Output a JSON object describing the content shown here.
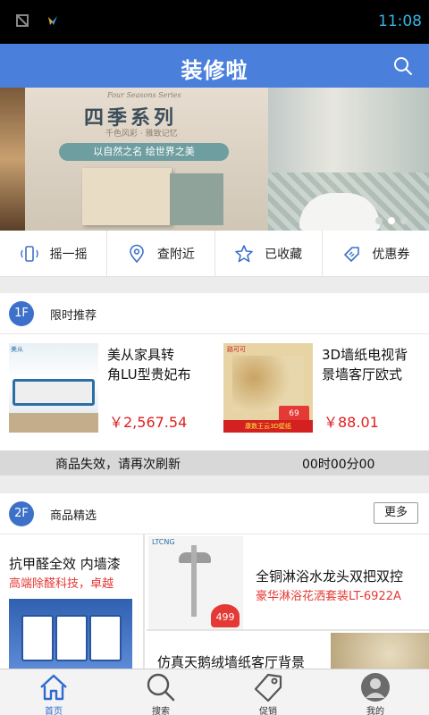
{
  "status_bar": {
    "time": "11:08",
    "icons": [
      "no-sim-icon",
      "app-notification-icon"
    ]
  },
  "app_bar": {
    "title": "装修啦",
    "search_icon": "search-icon"
  },
  "banner": {
    "slogan_en": "Four Seasons Series",
    "title": "四季系列",
    "subtitle": "千色风彩 · 雅致记忆",
    "pill": "以自然之名 绘世界之美",
    "page_count": 3,
    "active_page": 2
  },
  "quick_actions": [
    {
      "label": "摇一摇",
      "icon": "shake-phone-icon"
    },
    {
      "label": "查附近",
      "icon": "location-pin-icon"
    },
    {
      "label": "已收藏",
      "icon": "star-icon"
    },
    {
      "label": "优惠券",
      "icon": "coupon-icon"
    }
  ],
  "section1": {
    "badge": "1F",
    "title": "限时推荐",
    "products": [
      {
        "title_line1": "美从家具转",
        "title_line2": "角LU型贵妃布",
        "price": "￥2,567.54",
        "img_tag": "美从"
      },
      {
        "title_line1": "3D墙纸电视背",
        "title_line2": "景墙客厅欧式",
        "price": "￥88.01",
        "img_tag": "路可可",
        "img_strip": "康数王云3D壁纸",
        "img_price": "69"
      }
    ],
    "expire_msg": "商品失效，请再次刷新",
    "timer": "00时00分00"
  },
  "section2": {
    "badge": "2F",
    "title": "商品精选",
    "more": "更多",
    "left_card": {
      "title": "抗甲醛全效 内墙漆",
      "subtitle": "高端除醛科技，卓越"
    },
    "right_top_card": {
      "title": "全铜淋浴水龙头双把双控",
      "subtitle": "豪华淋浴花洒套装LT-6922A",
      "brand": "LTCNG",
      "price_tag": "499"
    },
    "right_bottom_card": {
      "title": "仿真天鹅绒墙纸客厅背景"
    }
  },
  "bottom_nav": [
    {
      "label": "首页",
      "icon": "home-icon",
      "active": true
    },
    {
      "label": "搜索",
      "icon": "search-icon",
      "active": false
    },
    {
      "label": "促销",
      "icon": "tag-icon",
      "active": false
    },
    {
      "label": "我的",
      "icon": "profile-icon",
      "active": false
    }
  ],
  "colors": {
    "primary": "#4a7fdc",
    "badge": "#3d71c9",
    "price": "#e02020",
    "status_time": "#33b5e5"
  }
}
